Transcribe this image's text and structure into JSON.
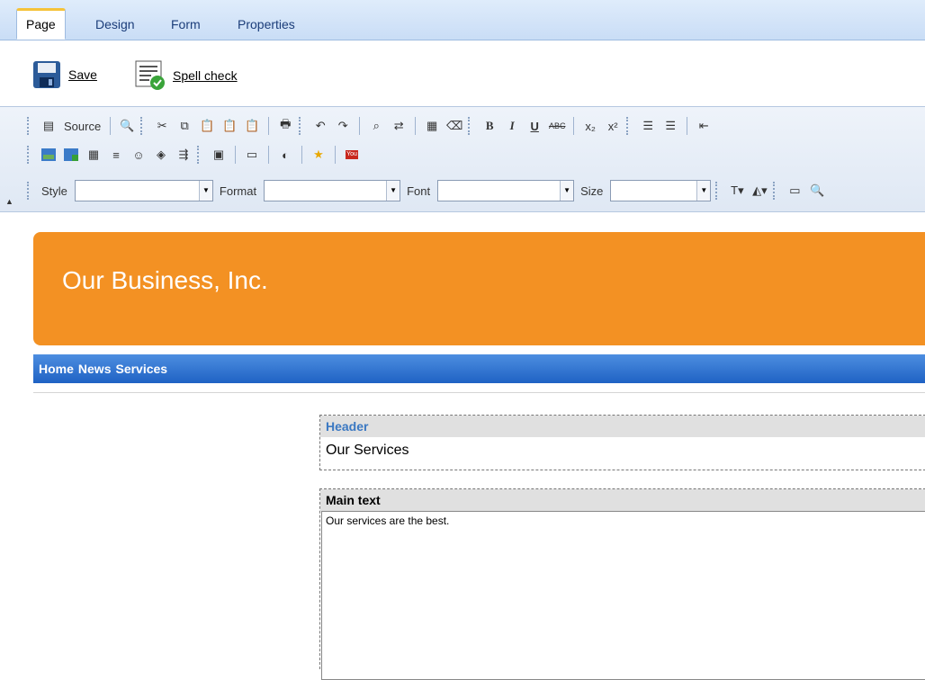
{
  "tabs": [
    {
      "label": "Page"
    },
    {
      "label": "Design"
    },
    {
      "label": "Form"
    },
    {
      "label": "Properties"
    }
  ],
  "actions": {
    "save_label": "Save",
    "spell_label": "Spell check"
  },
  "toolbar": {
    "source_label": "Source",
    "style_label": "Style",
    "format_label": "Format",
    "font_label": "Font",
    "size_label": "Size",
    "bold_glyph": "B",
    "italic_glyph": "I",
    "underline_glyph": "U",
    "strike_glyph": "ABC",
    "youtube_glyph": "You"
  },
  "page": {
    "banner_title": "Our Business, Inc.",
    "nav_links": [
      "Home",
      "News",
      "Services"
    ]
  },
  "regions": {
    "header_label": "Header",
    "header_value": "Our Services",
    "main_label": "Main text",
    "main_value": "Our services are the best."
  },
  "colors": {
    "banner": "#f39123",
    "nav": "#1f62c4",
    "active_tab_accent": "#f5c33a"
  }
}
